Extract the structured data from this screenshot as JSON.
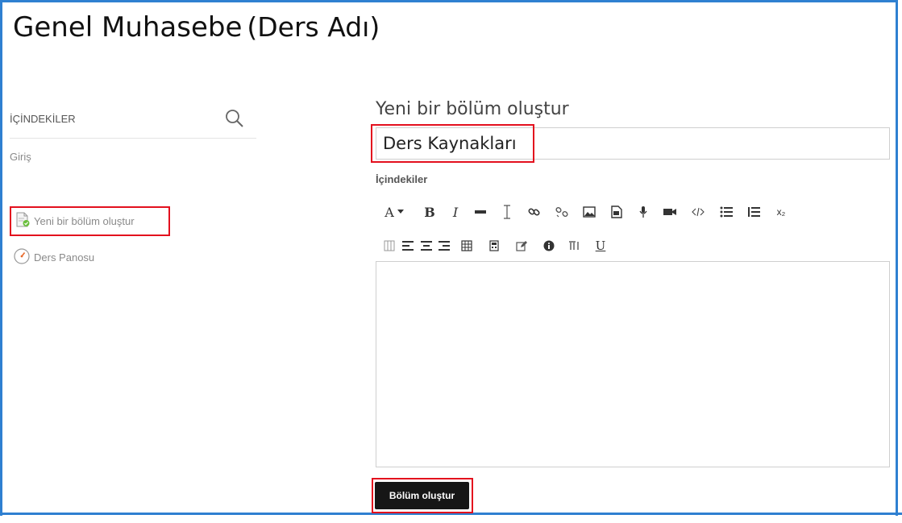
{
  "course": {
    "title": "Genel Muhasebe",
    "subtitle": "(Ders Adı)"
  },
  "sidebar": {
    "title": "İÇİNDEKİLER",
    "search_icon": "search-icon",
    "items": [
      {
        "label": "Giriş"
      },
      {
        "label": "Yeni bir bölüm oluştur",
        "icon": "new-page-icon"
      },
      {
        "label": "Ders Panosu",
        "icon": "dashboard-gauge-icon"
      }
    ]
  },
  "main": {
    "title": "Yeni bir bölüm oluştur",
    "section_name": {
      "value": "Ders Kaynakları"
    },
    "content_label": "İçindekiler",
    "toolbar": {
      "font_size": "A",
      "bold": "B",
      "italic": "I",
      "underline": "U",
      "subscript": "x₂"
    },
    "submit_label": "Bölüm oluştur"
  },
  "colors": {
    "frame": "#2f80d1",
    "highlight": "#e3101e",
    "button_bg": "#161616"
  }
}
